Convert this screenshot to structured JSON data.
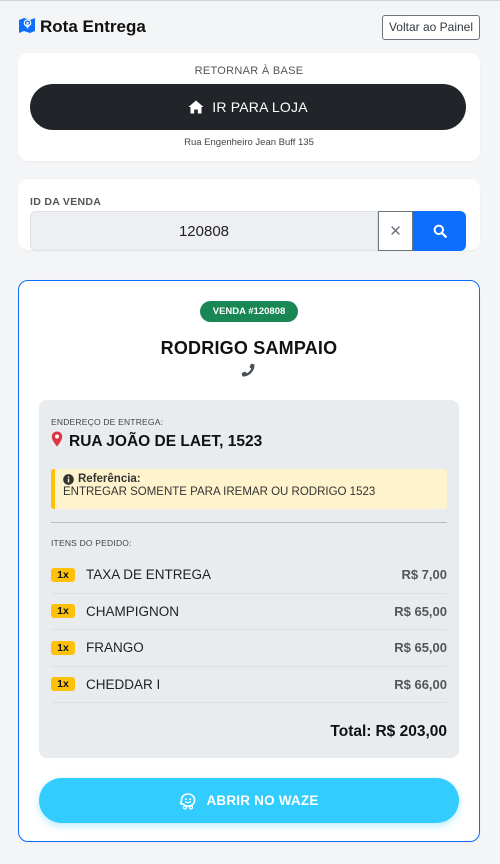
{
  "app": {
    "title": "Rota Entrega",
    "back_button": "Voltar ao Painel"
  },
  "base": {
    "label": "RETORNAR À BASE",
    "button_label": "IR PARA LOJA",
    "address": "Rua Engenheiro Jean Buff 135"
  },
  "search": {
    "label": "ID DA VENDA",
    "value": "120808",
    "clear_label": "✕"
  },
  "order": {
    "badge": "VENDA #120808",
    "customer": "RODRIGO SAMPAIO",
    "address_label": "ENDEREÇO DE ENTREGA:",
    "address": "RUA JOÃO DE LAET, 1523",
    "reference_title": "Referência:",
    "reference_text": "ENTREGAR SOMENTE PARA IREMAR OU RODRIGO 1523",
    "items_label": "ITENS DO PEDIDO:",
    "items": [
      {
        "qty": "1x",
        "name": "TAXA DE ENTREGA",
        "price": "R$ 7,00"
      },
      {
        "qty": "1x",
        "name": "CHAMPIGNON",
        "price": "R$ 65,00"
      },
      {
        "qty": "1x",
        "name": "FRANGO",
        "price": "R$ 65,00"
      },
      {
        "qty": "1x",
        "name": "CHEDDAR I",
        "price": "R$ 66,00"
      }
    ],
    "total_label": "Total:",
    "total_value": "R$ 203,00",
    "waze_button": "ABRIR NO WAZE"
  },
  "colors": {
    "primary": "#0d6efd",
    "dark": "#212529",
    "success": "#198754",
    "warning": "#ffc107",
    "waze": "#33ccff",
    "pin": "#dc3545"
  }
}
